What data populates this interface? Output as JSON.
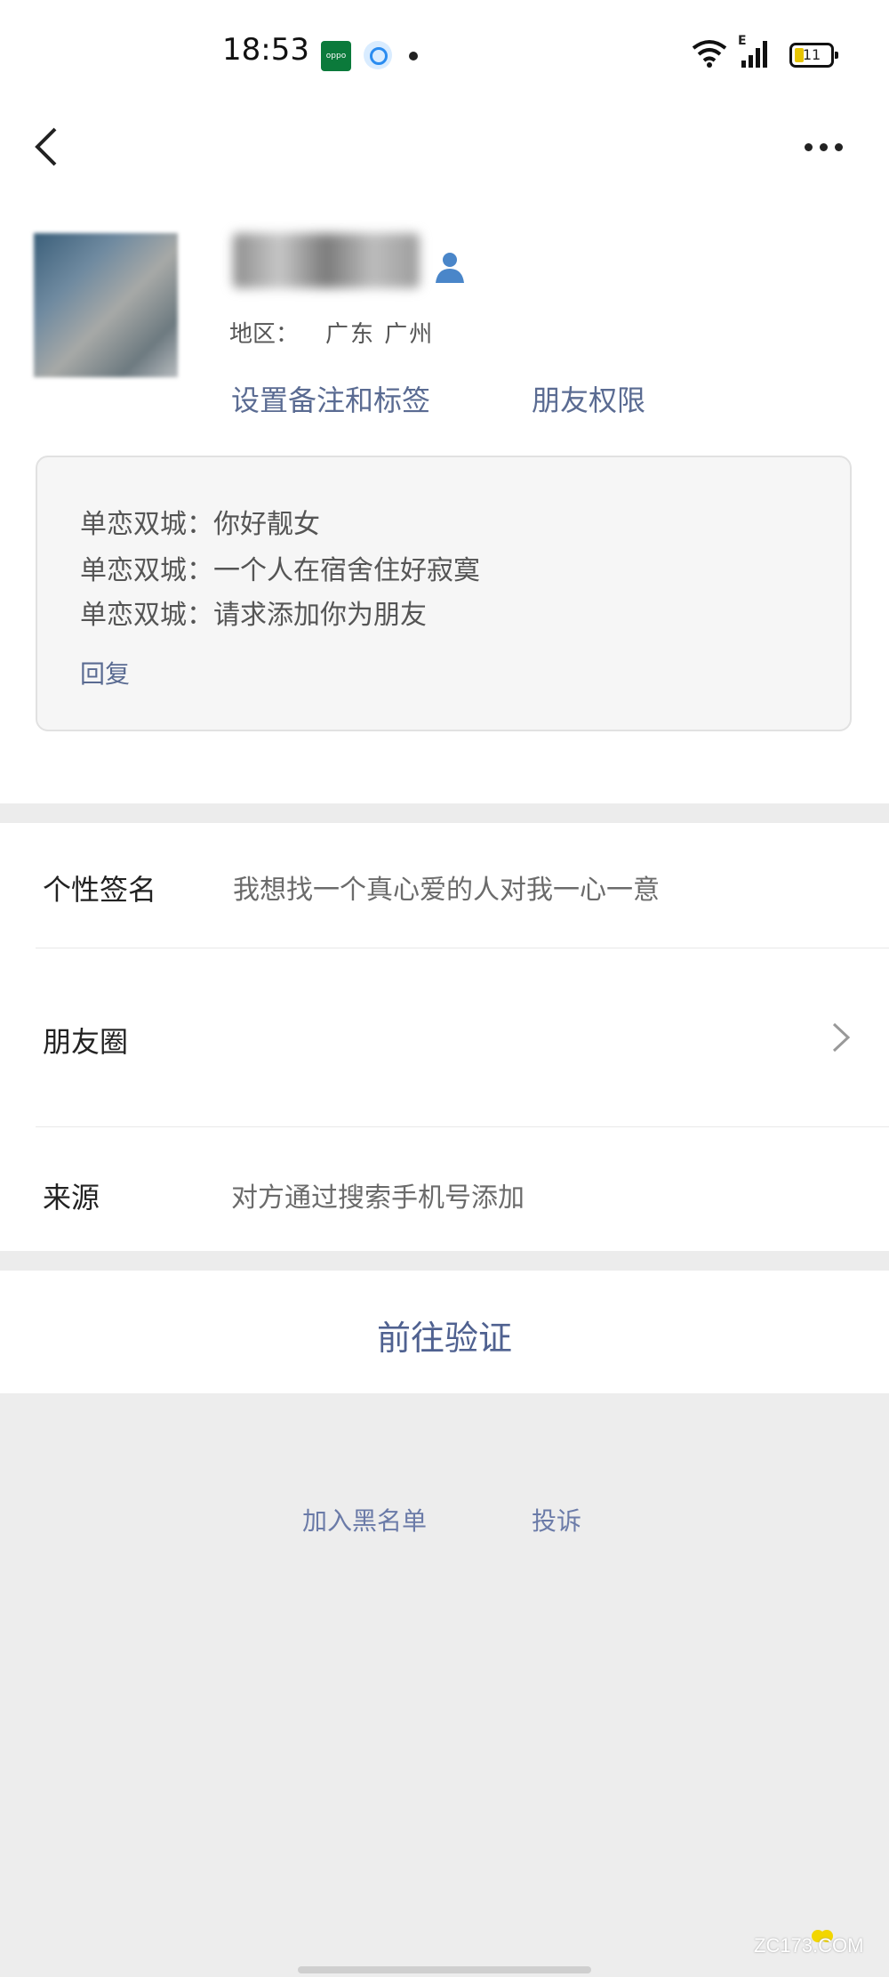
{
  "status_bar": {
    "time": "18:53",
    "app_badge_text": "oppo",
    "battery": "11",
    "network": "E"
  },
  "nav": {
    "back_icon": "chevron-left-icon",
    "more_icon": "more-dots-icon"
  },
  "profile": {
    "region_label": "地区：",
    "region_value": "广东 广州",
    "set_remark_label": "设置备注和标签",
    "friend_permission_label": "朋友权限"
  },
  "greeting": {
    "lines": [
      "单恋双城：你好靓女",
      "单恋双城：一个人在宿舍住好寂寞",
      "单恋双城：请求添加你为朋友"
    ],
    "reply_label": "回复"
  },
  "rows": {
    "signature_label": "个性签名",
    "signature_value": "我想找一个真心爱的人对我一心一意",
    "moments_label": "朋友圈",
    "source_label": "来源",
    "source_value": "对方通过搜索手机号添加"
  },
  "actions": {
    "verify_label": "前往验证",
    "blacklist_label": "加入黑名单",
    "complain_label": "投诉"
  },
  "watermark": "ZC173.COM",
  "colors": {
    "link": "#5a6b92",
    "background_gray": "#ededed",
    "box_bg": "#f6f6f6"
  }
}
